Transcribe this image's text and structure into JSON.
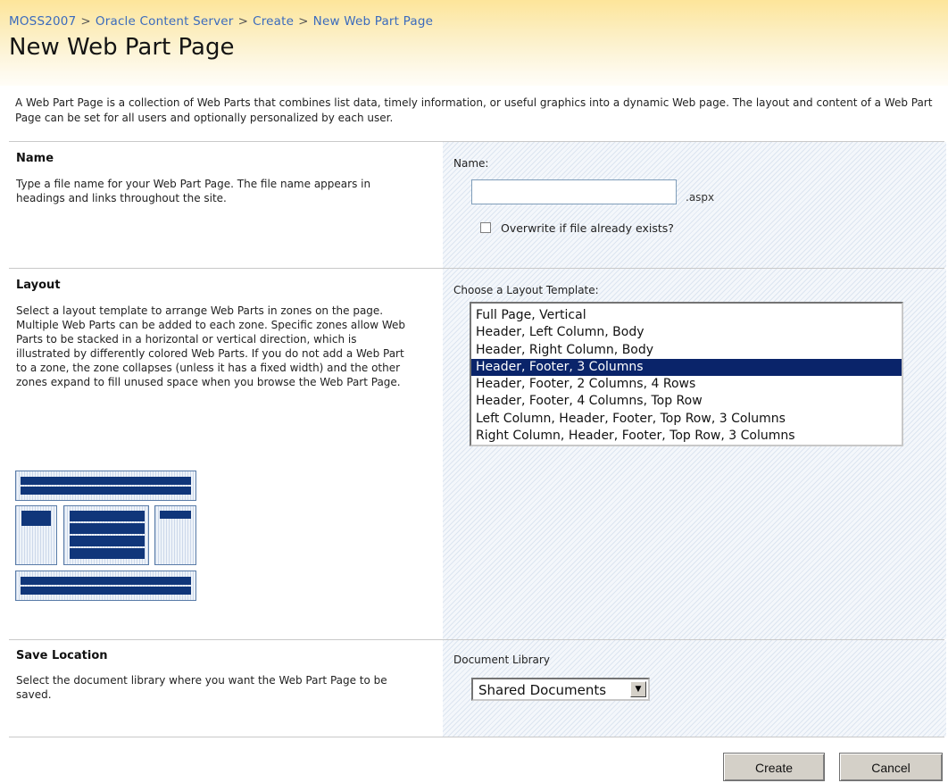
{
  "breadcrumb": {
    "items": [
      "MOSS2007",
      "Oracle Content Server",
      "Create"
    ],
    "separator": ">",
    "current": "New Web Part Page"
  },
  "page_title": "New Web Part Page",
  "intro": "A Web Part Page is a collection of Web Parts that combines list data, timely information, or useful graphics into a dynamic Web page. The layout and content of a Web Part Page can be set for all users and optionally personalized by each user.",
  "name_section": {
    "title": "Name",
    "description": "Type a file name for your Web Part Page.  The file name appears in headings and links throughout the site.",
    "field_label": "Name:",
    "value": "",
    "extension": ".aspx",
    "overwrite_label": "Overwrite if file already exists?",
    "overwrite_checked": false
  },
  "layout_section": {
    "title": "Layout",
    "description": "Select a layout template to arrange Web Parts in zones on the page. Multiple Web Parts can be added to each zone. Specific zones allow Web Parts to be stacked in a horizontal or vertical direction, which is illustrated by differently colored Web Parts. If you do not add a Web Part to a zone, the zone collapses (unless it has a fixed width) and the other zones expand to fill unused space when you browse the Web Part Page.",
    "field_label": "Choose a Layout Template:",
    "options": [
      "Full Page, Vertical",
      "Header, Left Column, Body",
      "Header, Right Column, Body",
      "Header, Footer, 3 Columns",
      "Header, Footer, 2 Columns, 4 Rows",
      "Header, Footer, 4 Columns, Top Row",
      "Left Column, Header, Footer, Top Row, 3 Columns",
      "Right Column, Header, Footer, Top Row, 3 Columns"
    ],
    "selected": "Header, Footer, 3 Columns"
  },
  "save_section": {
    "title": "Save Location",
    "description": "Select the document library where you want the Web Part Page to be saved.",
    "field_label": "Document Library",
    "selected": "Shared Documents"
  },
  "buttons": {
    "create": "Create",
    "cancel": "Cancel"
  },
  "colors": {
    "selection": "#0a246a",
    "link": "#3b6bbd",
    "zone_bar": "#10367a"
  }
}
